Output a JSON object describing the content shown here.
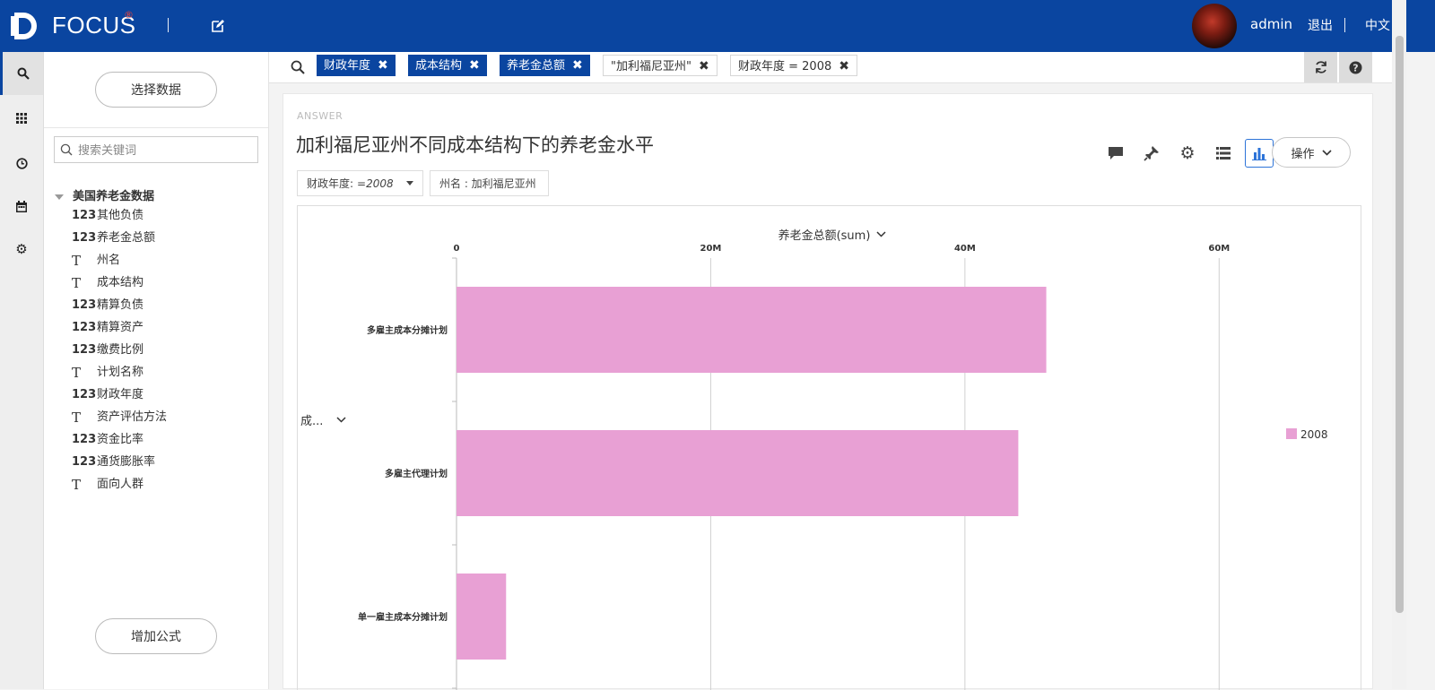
{
  "app": {
    "logo_text": "FOCUS",
    "logo_sup": "®",
    "user": "admin",
    "logout": "退出",
    "language": "中文"
  },
  "colors": {
    "topbar": "#0a45a0",
    "chip_dark": "#0a45a0",
    "bar": "#e8a0d4",
    "accent": "#2d74d8"
  },
  "nav_icons": [
    "search-icon",
    "grid-icon",
    "history-icon",
    "calendar-icon",
    "settings-icon"
  ],
  "sidebar": {
    "select_data": "选择数据",
    "search_placeholder": "搜索关键词",
    "dataset": "美国养老金数据",
    "fields": [
      {
        "type": "123",
        "name": "其他负债"
      },
      {
        "type": "123",
        "name": "养老金总额"
      },
      {
        "type": "T",
        "name": "州名"
      },
      {
        "type": "T",
        "name": "成本结构"
      },
      {
        "type": "123",
        "name": "精算负债"
      },
      {
        "type": "123",
        "name": "精算资产"
      },
      {
        "type": "123",
        "name": "缴费比例"
      },
      {
        "type": "T",
        "name": "计划名称"
      },
      {
        "type": "123",
        "name": "财政年度"
      },
      {
        "type": "T",
        "name": "资产评估方法"
      },
      {
        "type": "123",
        "name": "资金比率"
      },
      {
        "type": "123",
        "name": "通货膨胀率"
      },
      {
        "type": "T",
        "name": "面向人群"
      }
    ],
    "add_formula": "增加公式"
  },
  "search": {
    "chips": [
      {
        "label": "财政年度",
        "style": "dark",
        "close": "✖"
      },
      {
        "label": "成本结构",
        "style": "dark",
        "close": "✖"
      },
      {
        "label": "养老金总额",
        "style": "dark",
        "close": "✖"
      },
      {
        "label": "\"加利福尼亚州\"",
        "style": "light",
        "close": "✖"
      },
      {
        "label": "财政年度 = 2008",
        "style": "light",
        "close": "✖"
      }
    ]
  },
  "answer": {
    "label": "ANSWER",
    "title": "加利福尼亚州不同成本结构下的养老金水平",
    "operations": "操作",
    "filter_year_label": "财政年度:",
    "filter_year_value": "=2008",
    "filter_state": "州名 : 加利福尼亚州"
  },
  "chart_data": {
    "type": "bar",
    "orientation": "horizontal",
    "xlabel": "养老金总额(sum)",
    "ylabel": "成...",
    "categories": [
      "多雇主成本分摊计划",
      "多雇主代理计划",
      "单一雇主成本分摊计划"
    ],
    "series": [
      {
        "name": "2008",
        "values": [
          46400000,
          44200000,
          3900000
        ],
        "color": "#e8a0d4"
      }
    ],
    "xlim": [
      0,
      64000000
    ],
    "ticks": [
      0,
      20000000,
      40000000,
      60000000
    ],
    "tick_labels": [
      "0",
      "20M",
      "40M",
      "60M"
    ],
    "grid": true,
    "legend": "right"
  }
}
